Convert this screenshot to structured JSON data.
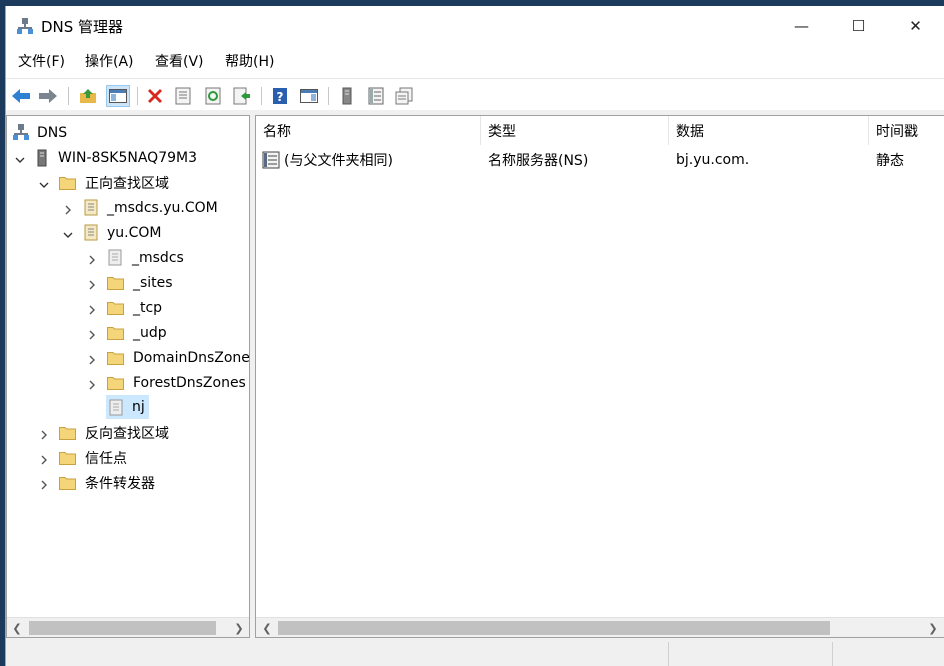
{
  "window": {
    "title": "DNS 管理器",
    "controls": {
      "minimize": "—",
      "maximize": "☐",
      "close": "✕"
    }
  },
  "menu": [
    "文件(F)",
    "操作(A)",
    "查看(V)",
    "帮助(H)"
  ],
  "toolbar": {
    "icons": [
      "back-arrow-icon",
      "forward-arrow-icon",
      "up-folder-icon",
      "show-hide-console-tree-icon",
      "delete-icon",
      "properties-icon",
      "refresh-icon",
      "export-list-icon",
      "help-icon",
      "show-action-pane-icon",
      "server-icon",
      "record-list-icon",
      "records-icon"
    ]
  },
  "tree": {
    "root": "DNS",
    "server": "WIN-8SK5NAQ79M3",
    "forward_zones": "正向查找区域",
    "msdcs_zone": "_msdcs.yu.COM",
    "yu_zone": "yu.COM",
    "children": [
      "_msdcs",
      "_sites",
      "_tcp",
      "_udp",
      "DomainDnsZones",
      "ForestDnsZones",
      "nj"
    ],
    "reverse_zones": "反向查找区域",
    "trust_points": "信任点",
    "conditional_forwarders": "条件转发器"
  },
  "list": {
    "columns": [
      "名称",
      "类型",
      "数据",
      "时间戳"
    ],
    "rows": [
      {
        "name": "(与父文件夹相同)",
        "type": "名称服务器(NS)",
        "data": "bj.yu.com.",
        "timestamp": "静态"
      }
    ]
  },
  "colors": {
    "accent_selection": "#cce8ff",
    "folder_yellow": "#f5d57a",
    "delete_red": "#d9281e",
    "arrow_blue": "#2f7fd3"
  }
}
